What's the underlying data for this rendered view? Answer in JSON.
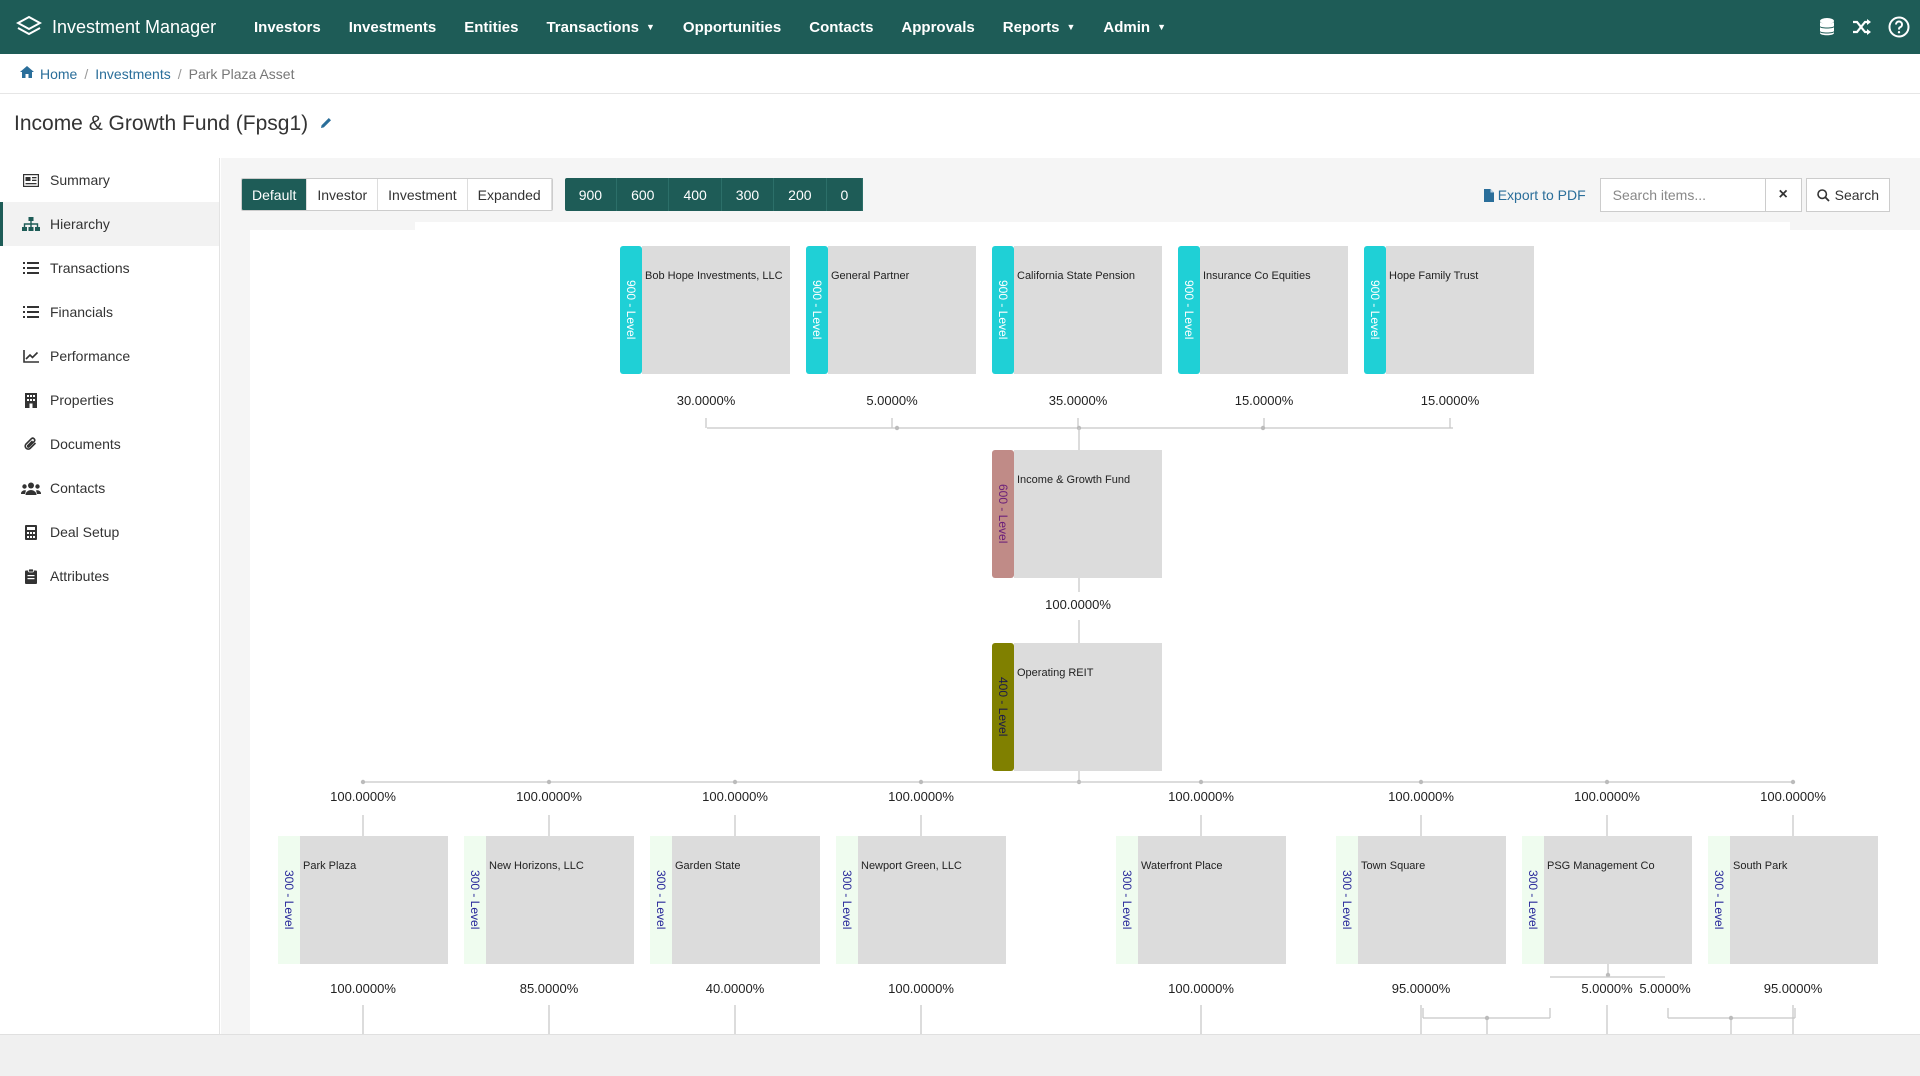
{
  "nav": {
    "brand": "Investment Manager",
    "items": [
      {
        "label": "Investors",
        "caret": false
      },
      {
        "label": "Investments",
        "caret": false
      },
      {
        "label": "Entities",
        "caret": false
      },
      {
        "label": "Transactions",
        "caret": true
      },
      {
        "label": "Opportunities",
        "caret": false
      },
      {
        "label": "Contacts",
        "caret": false
      },
      {
        "label": "Approvals",
        "caret": false
      },
      {
        "label": "Reports",
        "caret": true
      },
      {
        "label": "Admin",
        "caret": true
      }
    ],
    "right_icons": [
      "database-icon",
      "shuffle-icon",
      "help-icon"
    ]
  },
  "breadcrumb": {
    "home": "Home",
    "investments": "Investments",
    "current": "Park Plaza Asset"
  },
  "page": {
    "title": "Income & Growth Fund (Fpsg1)"
  },
  "sidebar": {
    "items": [
      {
        "label": "Summary",
        "icon": "summary-icon",
        "active": false
      },
      {
        "label": "Hierarchy",
        "icon": "hierarchy-icon",
        "active": true
      },
      {
        "label": "Transactions",
        "icon": "list-icon",
        "active": false
      },
      {
        "label": "Financials",
        "icon": "list-icon",
        "active": false
      },
      {
        "label": "Performance",
        "icon": "chart-icon",
        "active": false
      },
      {
        "label": "Properties",
        "icon": "building-icon",
        "active": false
      },
      {
        "label": "Documents",
        "icon": "paperclip-icon",
        "active": false
      },
      {
        "label": "Contacts",
        "icon": "users-icon",
        "active": false
      },
      {
        "label": "Deal Setup",
        "icon": "calculator-icon",
        "active": false
      },
      {
        "label": "Attributes",
        "icon": "clipboard-icon",
        "active": false
      }
    ]
  },
  "toolbar": {
    "views": [
      "Default",
      "Investor",
      "Investment",
      "Expanded"
    ],
    "active_view": "Default",
    "levels": [
      "900",
      "600",
      "400",
      "300",
      "200",
      "0"
    ],
    "export_label": "Export to PDF",
    "search_placeholder": "Search items...",
    "search_label": "Search"
  },
  "hierarchy": {
    "level_colors": {
      "900": "#1fd0d6",
      "600": "#c08b87",
      "400": "#808000",
      "300": "#effcef"
    },
    "investors": [
      {
        "name": "Bob Hope Investments, LLC",
        "level": "900 - Level",
        "pct": "30.0000%"
      },
      {
        "name": "General Partner",
        "level": "900 - Level",
        "pct": "5.0000%"
      },
      {
        "name": "California State Pension",
        "level": "900 - Level",
        "pct": "35.0000%"
      },
      {
        "name": "Insurance Co Equities",
        "level": "900 - Level",
        "pct": "15.0000%"
      },
      {
        "name": "Hope Family Trust",
        "level": "900 - Level",
        "pct": "15.0000%"
      }
    ],
    "fund": {
      "name": "Income & Growth Fund",
      "level": "600 - Level",
      "pct": "100.0000%"
    },
    "reit": {
      "name": "Operating REIT",
      "level": "400 - Level"
    },
    "properties": [
      {
        "name": "Park Plaza",
        "level": "300 - Level",
        "pct_in": "100.0000%",
        "pct_out": "100.0000%"
      },
      {
        "name": "New Horizons, LLC",
        "level": "300 - Level",
        "pct_in": "100.0000%",
        "pct_out": "85.0000%"
      },
      {
        "name": "Garden State",
        "level": "300 - Level",
        "pct_in": "100.0000%",
        "pct_out": "40.0000%"
      },
      {
        "name": "Newport Green, LLC",
        "level": "300 - Level",
        "pct_in": "100.0000%",
        "pct_out": "100.0000%"
      },
      {
        "name": "Waterfront Place",
        "level": "300 - Level",
        "pct_in": "100.0000%",
        "pct_out": "100.0000%"
      },
      {
        "name": "Town Square",
        "level": "300 - Level",
        "pct_in": "100.0000%",
        "pct_out": "95.0000%"
      },
      {
        "name": "PSG Management Co",
        "level": "300 - Level",
        "pct_in": "100.0000%",
        "pct_out": "5.0000%"
      },
      {
        "name": "South Park",
        "level": "300 - Level",
        "pct_in": "100.0000%",
        "pct_out": "95.0000%"
      }
    ],
    "extra_pct": "5.0000%"
  }
}
